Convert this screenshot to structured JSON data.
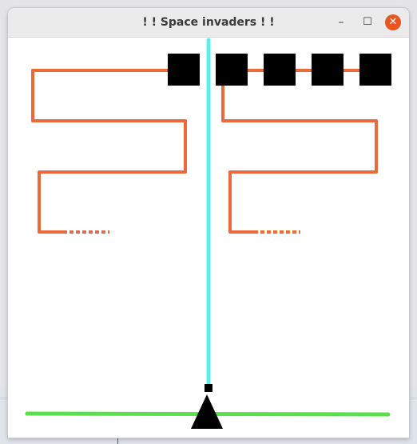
{
  "window": {
    "title": "! ! Space invaders ! !",
    "minimize_icon": "minimize-icon",
    "maximize_icon": "maximize-icon",
    "close_icon": "close-icon",
    "minimize_glyph": "–",
    "maximize_glyph": "☐",
    "close_glyph": "✕"
  },
  "game": {
    "background": "#ffffff",
    "invader_color": "#000000",
    "invader_count": 5,
    "laser_color": "#5cefee",
    "ground_color": "#5ae04a",
    "path_color": "#ea6a3c",
    "player_color": "#000000",
    "player_icon": "triangle-ship-icon"
  }
}
